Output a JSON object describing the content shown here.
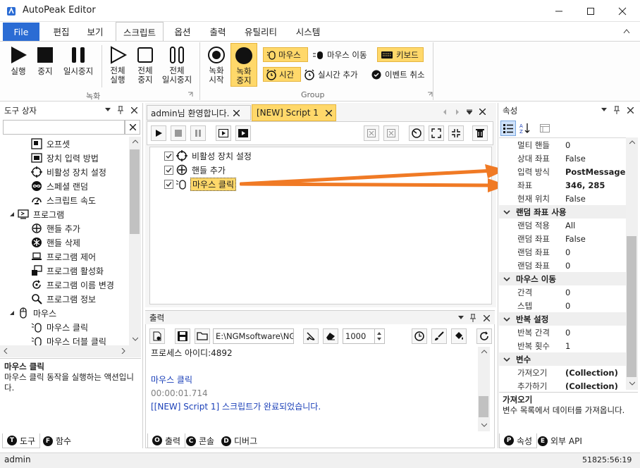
{
  "window": {
    "title": "AutoPeak Editor"
  },
  "menu": {
    "file": "File",
    "items": [
      "편집",
      "보기",
      "스크립트",
      "옵션",
      "출력",
      "유틸리티",
      "시스템"
    ]
  },
  "ribbon": {
    "run": "실행",
    "stop": "중지",
    "pause": "일시중지",
    "run_all_1": "전체",
    "run_all_2": "실행",
    "stop_all_1": "전체",
    "stop_all_2": "중지",
    "pause_all_1": "전체",
    "pause_all_2": "일시중지",
    "rec_start_1": "녹화",
    "rec_start_2": "시작",
    "rec_stop_1": "녹화",
    "rec_stop_2": "중지",
    "mouse": "마우스",
    "mouse_move": "마우스 이동",
    "keyboard": "키보드",
    "time": "시간",
    "add_realtime": "실시간 추가",
    "cancel_event": "이벤트 취소",
    "group_record": "녹화",
    "group_group": "Group"
  },
  "toolbox": {
    "title": "도구 상자",
    "items": [
      {
        "label": "오프셋",
        "icon": "offset-icon",
        "level": 2
      },
      {
        "label": "장치 입력 방법",
        "icon": "device-input-icon",
        "level": 2
      },
      {
        "label": "비활성 장치 설정",
        "icon": "crosshair-icon",
        "level": 2
      },
      {
        "label": "스페셜 랜덤",
        "icon": "infinity-icon",
        "level": 2
      },
      {
        "label": "스크립트 속도",
        "icon": "speed-icon",
        "level": 2
      },
      {
        "label": "프로그램",
        "icon": "program-icon",
        "level": 1
      },
      {
        "label": "핸들 추가",
        "icon": "target-icon",
        "level": 2
      },
      {
        "label": "핸들 삭제",
        "icon": "asterisk-icon",
        "level": 2
      },
      {
        "label": "프로그램 제어",
        "icon": "laptop-icon",
        "level": 2
      },
      {
        "label": "프로그램 활성화",
        "icon": "windows-icon",
        "level": 2
      },
      {
        "label": "프로그램 이름 변경",
        "icon": "refresh-icon",
        "level": 2
      },
      {
        "label": "프로그램 정보",
        "icon": "magnifier-icon",
        "level": 2
      },
      {
        "label": "마우스",
        "icon": "mouse-icon",
        "level": 1
      },
      {
        "label": "마우스 클릭",
        "icon": "mouse-click-icon",
        "level": 2
      },
      {
        "label": "마우스 더블 클릭",
        "icon": "mouse-click-icon",
        "level": 2
      }
    ],
    "desc_title": "마우스 클릭",
    "desc_text": "마우스 클릭 동작을 실행하는 액션입니다.",
    "tabs": [
      "도구",
      "함수"
    ]
  },
  "editor": {
    "tabs": [
      "admin님 환영합니다.",
      "[NEW] Script 1"
    ],
    "steps": [
      "비활성 장치 설정",
      "핸들 추가",
      "마우스 클릭"
    ]
  },
  "output": {
    "title": "출력",
    "path": "E:\\NGMsoftware\\NG",
    "delay": "1000",
    "lines": [
      {
        "text": "프로세스 아이디:4892",
        "color": "#1e1e1e"
      },
      {
        "text": "",
        "color": "#1e1e1e"
      },
      {
        "text": "마우스 클릭",
        "color": "#1a3fb8"
      },
      {
        "text": "00:00:01.714",
        "color": "#808080"
      },
      {
        "text": "[[NEW] Script 1] 스크립트가 완료되었습니다.",
        "color": "#1a3fb8"
      }
    ],
    "tabs": [
      "출력",
      "콘솔",
      "디버그"
    ]
  },
  "properties": {
    "title": "속성",
    "rows": [
      {
        "k": "멀티 핸들",
        "v": "0"
      },
      {
        "k": "상대 좌표",
        "v": "False"
      },
      {
        "k": "입력 방식",
        "v": "PostMessage",
        "bold": true
      },
      {
        "k": "좌표",
        "v": "346, 285",
        "bold": true
      },
      {
        "k": "현재 위치",
        "v": "False"
      },
      {
        "group": "랜덤 좌표 사용"
      },
      {
        "k": "랜덤 적용",
        "v": "All"
      },
      {
        "k": "랜덤 좌표",
        "v": "False"
      },
      {
        "k": "랜덤 좌표",
        "v": "0"
      },
      {
        "k": "랜덤 좌표",
        "v": "0"
      },
      {
        "group": "마우스 이동"
      },
      {
        "k": "간격",
        "v": "0"
      },
      {
        "k": "스텝",
        "v": "0"
      },
      {
        "group": "반복 설정"
      },
      {
        "k": "반복 간격",
        "v": "0"
      },
      {
        "k": "반복 횟수",
        "v": "1"
      },
      {
        "group": "변수"
      },
      {
        "k": "가져오기",
        "v": "(Collection)",
        "bold": true
      },
      {
        "k": "추가하기",
        "v": "(Collection)",
        "bold": true
      }
    ],
    "desc_title": "가져오기",
    "desc_text": "변수 목록에서 데이터를 가져옵니다.",
    "tabs": [
      "속성",
      "외부 API"
    ]
  },
  "status": {
    "user": "admin",
    "time": "51825:56:19"
  },
  "colors": {
    "accent": "#2b6cd4",
    "highlight": "#ffd86a",
    "arrow": "#f07a25"
  }
}
